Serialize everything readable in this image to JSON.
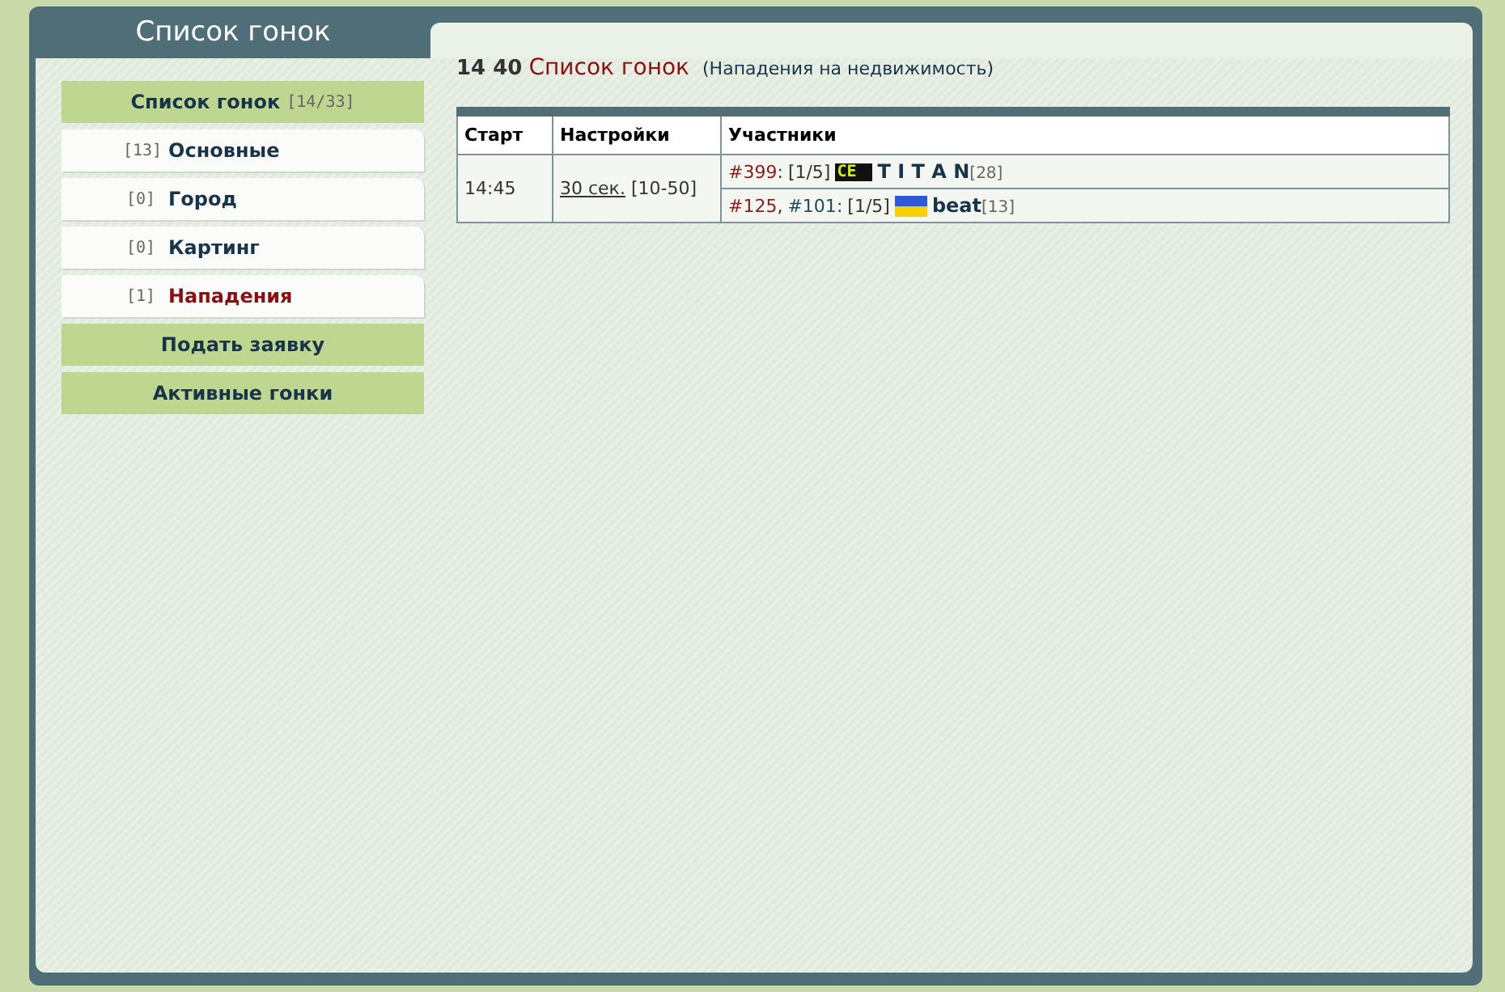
{
  "window": {
    "title": "Список гонок"
  },
  "sidebar": {
    "items": [
      {
        "kind": "header",
        "label": "Список гонок",
        "count": "[14/33]"
      },
      {
        "kind": "category",
        "count": "[13]",
        "label": "Основные",
        "selected": false
      },
      {
        "kind": "category",
        "count": "[0]",
        "label": "Город",
        "selected": false
      },
      {
        "kind": "category",
        "count": "[0]",
        "label": "Картинг",
        "selected": false
      },
      {
        "kind": "category",
        "count": "[1]",
        "label": "Нападения",
        "selected": true
      },
      {
        "kind": "button",
        "label": "Подать заявку"
      },
      {
        "kind": "button",
        "label": "Активные гонки"
      }
    ]
  },
  "heading": {
    "time": "14 40",
    "title": "Список гонок",
    "subtitle": "(Нападения на недвижимость)"
  },
  "table": {
    "columns": [
      "Старт",
      "Настройки",
      "Участники"
    ],
    "rows": [
      {
        "start": "14:45",
        "timeout": "30 сек.",
        "range": "[10-50]",
        "participants": [
          {
            "ids": [
              {
                "text": "#399",
                "color": "#8b1a1a",
                "sep": ":"
              }
            ],
            "slots": "[1/5]",
            "badge": {
              "kind": "clan",
              "text": "CE"
            },
            "name": "T I T A N",
            "level": "[28]"
          },
          {
            "ids": [
              {
                "text": "#125",
                "color": "#8b1a1a",
                "sep": ","
              },
              {
                "text": "#101",
                "color": "#1d4b5a",
                "sep": ":"
              }
            ],
            "slots": "[1/5]",
            "badge": {
              "kind": "flag"
            },
            "name": "beat",
            "level": "[13]"
          }
        ]
      }
    ]
  }
}
